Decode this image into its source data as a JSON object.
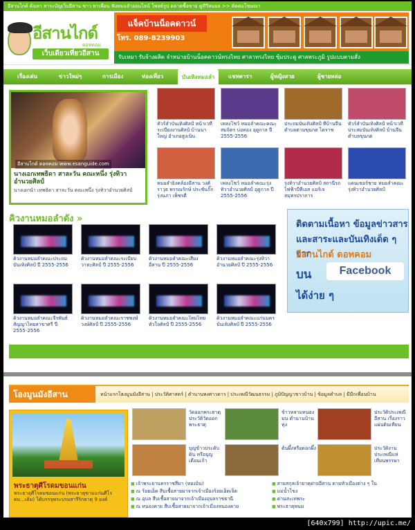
{
  "topbar": {
    "text": "อีสานไกด์ ค้นหา สาระบัญเว็บอีสาน ข่าว หาเพื่อน ฟังหมอลำออนไลน์ โพสต์รูป ตลาดซื้อขาย ดูทีวีหมอล >> ติดต่อโฆษณา"
  },
  "header": {
    "brand": "อีสานไกด์",
    "dotcom": "ดอทคอม",
    "tagline": "เว็บเดียวเที่ยวอีสาน",
    "banner_title": "แจ็คบ้านน็อคดาวน์",
    "banner_phone": "โทร. 089-8239903",
    "banner_sub": "รับเหมา รับจ้างผลิต จำหน่ายบ้านน็อคดาวน์ทรงไทย ศาลาทรงไทย ซุ้มประตู ศาลพระภูมิ รูปแบบตามสั่ง"
  },
  "nav": {
    "items": [
      "เรื่องเด่น",
      "ข่าวใหม่ๆ",
      "การเมือง",
      "ท่องเที่ยว",
      "บันเทิง",
      "ดาราศาสตร์",
      "ผู้หญิงสวย",
      "ผู้ชายหล่อ"
    ],
    "active": "บันเทิงหมอลำ",
    "labels": [
      "เรื่องเด่น",
      "ข่าวใหม่ๆ",
      "การเมือง",
      "ท่องเที่ยว",
      "บันเทิงหมอลำ",
      "แชทดารา",
      "ผู้หญิงสวย",
      "ผู้ชายหล่อ"
    ]
  },
  "feature": {
    "watermark": "อีสานไกด์ ดอทคอม www.esanguide.com",
    "title": "นางเอกเทพธิดา สาละวัน คณะหนึ่ง รุ่งทิวา อำนวยศิลป์",
    "desc": "นางเอกนำ เทพธิดา สาละวัน คณะหนึ่ง รุ่งทิวาอำนวยศิลป์"
  },
  "thumbs": [
    {
      "cap": "ทัวร์ลำบันเทิงศิลป์ หน้าเวทีระเบียงงานศิลป์ บ้านนาใหญ่ อำเภอสูงเนิน",
      "color": "#b03a2a"
    },
    {
      "cap": "เพลงโชว์ หมอลำคณะคณะสมจิตร บ่อทอง อุดูกาล ปี 2555-2556",
      "color": "#5a3a8a"
    },
    {
      "cap": "ประถมบันเทิงศิลป์ ที่บ้านจีน ตำบลตามขุนกต ไตราช",
      "color": "#a06a2a"
    },
    {
      "cap": "ทัวร์ลำบันเทิงศิลป์ หน้าเวทีประสมบันเทิงศิลป์ บ้านจีน ตำบลขุนกต",
      "color": "#c04a6a"
    },
    {
      "cap": "หมอลำยิ่งคล้องอีสาน วงศ์ราวุธ พรรณรักษ์ ประชันกิ๊ก รุ่งนภา เพ็ชรดี",
      "color": "#d06040"
    },
    {
      "cap": "เพลงโชว์ หมอลำคณะรุ่งทิวาอำนวยศิลป์ อุดูกาล ปี 2555-2556",
      "color": "#3a6ab0"
    },
    {
      "cap": "รุ่งทิวาอำนวยศิลป์ สถานีรถไฟฟ้าบีทีเอส แอร์เจสมุทรปราการ",
      "color": "#b02a4a"
    },
    {
      "cap": "แดนเซอร์ชาย หมอลำคณะรุ่งทิวาอำนวยศิลป์",
      "color": "#2a4ab0"
    }
  ],
  "lower": {
    "heading": "คิวงานหมอลำดัง »",
    "videos": [
      {
        "cap": "คิวงานหมอลำคณะประถมบันเทิงศิลป์ ปี 2555-2556"
      },
      {
        "cap": "คิวงานหมอลำคณะระเบียบวาทะศิลป์ ปี 2555-2556"
      },
      {
        "cap": "คิวงานหมอลำคณะเสียงอีสาน ปี 2555-2556"
      },
      {
        "cap": "คิวงานหมอลำคณะรุ่งทิวาอำนวยศิลป์ ปี 2555-2556"
      },
      {
        "cap": "คิวงานหมอลำคณะจีรพันธ์สัญญาไทยสาขาศรี ปี 2555-2556"
      },
      {
        "cap": "คิวงานหมอลำคณะราชพงษ์ วงษ์ศิลป์ ปี 2555-2556"
      },
      {
        "cap": "คิวงานหมอลำคณะใหม่ไทย หัวใจศิลป์ ปี 2555-2556"
      },
      {
        "cap": "คิวงานหมอลำคณะแก่นนครบันเทิงศิลป์ ปี 2555-2556"
      }
    ]
  },
  "facebook": {
    "line1": "ติดตามเนื้อหา ข้อมูลข่าวสาร",
    "line2": "และสาระและบันเทิงเด็ด ๆ จาก",
    "line3": "อีสานไกด์ ดอทคอม",
    "line4": "บน",
    "button": "Facebook",
    "line5": "ได้ง่าย ๆ"
  },
  "bottom": {
    "heading": "โองมูนมังอีสาน",
    "links": "หน้าแรกโฮงมูนมังอีสาน | ประวัติศาสตร์ | ตำนานพงศาวดาร | ประเพณีวัฒนธรรม | ภูมิปัญญาชาวบ้าน | ข้อมูลตำบล | มีมีกเพื่อนบ้าน",
    "feature_title": "พระธาตุศีโรดมขอนแก่น",
    "feature_desc": "พระธาตุศีโรดมขอนแก่น (พระธาตุขามแก่นศีโรดม...เดิม) ได้บรรจุพระบรมสารีริกธาตุ 9 องค์",
    "items": [
      {
        "cap": "วัดออกพระธาตุ ประวัติวัดออกพระธาตุ",
        "color": "#c0a060"
      },
      {
        "cap": "ข้าวหลามหนองมน ตำนานบ้านทุ่ง",
        "color": "#5a8a3a"
      },
      {
        "cap": "ประวัติประเพณี อีสาน เรื่องราวแผ่นดินเทียน",
        "color": "#a04020"
      },
      {
        "cap": "ประวัติประเพณีแห่นาคโบราณ",
        "color": "#d0a020"
      },
      {
        "cap": "บุญข้าวประดับดิน หรือบุญเดือนเก้า",
        "color": "#c08040"
      },
      {
        "cap": "ต้นผึ้งหรือดอกผึ้ง",
        "color": "#8a6a3a"
      },
      {
        "cap": "",
        "color": "#a08060"
      },
      {
        "cap": "ประวัติงานประเพณีแห่เทียนพรรษา",
        "color": "#c09030"
      }
    ],
    "list_left": [
      "เจ้าพระยานครราชสีมา (ทองอิน)",
      "ณ ร้อยเอ็ด สืบเชื้อสายมาจากเจ้าเมืองร้อยเอ็ดเจ็ด",
      "ณ อุบล สืบเชื้อสายมาจากเจ้าเมืองอุบลราชธานี",
      "ณ หนองคาย สืบเชื้อสายมาจากเจ้าเมืองหนองคาย"
    ],
    "list_right": [
      "สายสกุลเจ้ายาคุฝายอีสาน ตามหัวเมืองต่าง ๆ ใน",
      "แม่น้ำโขง",
      "ด่านสะเทพระ",
      "พระธาตุพนม"
    ]
  },
  "footer": {
    "text": "[640x799] http://upic.me/"
  }
}
